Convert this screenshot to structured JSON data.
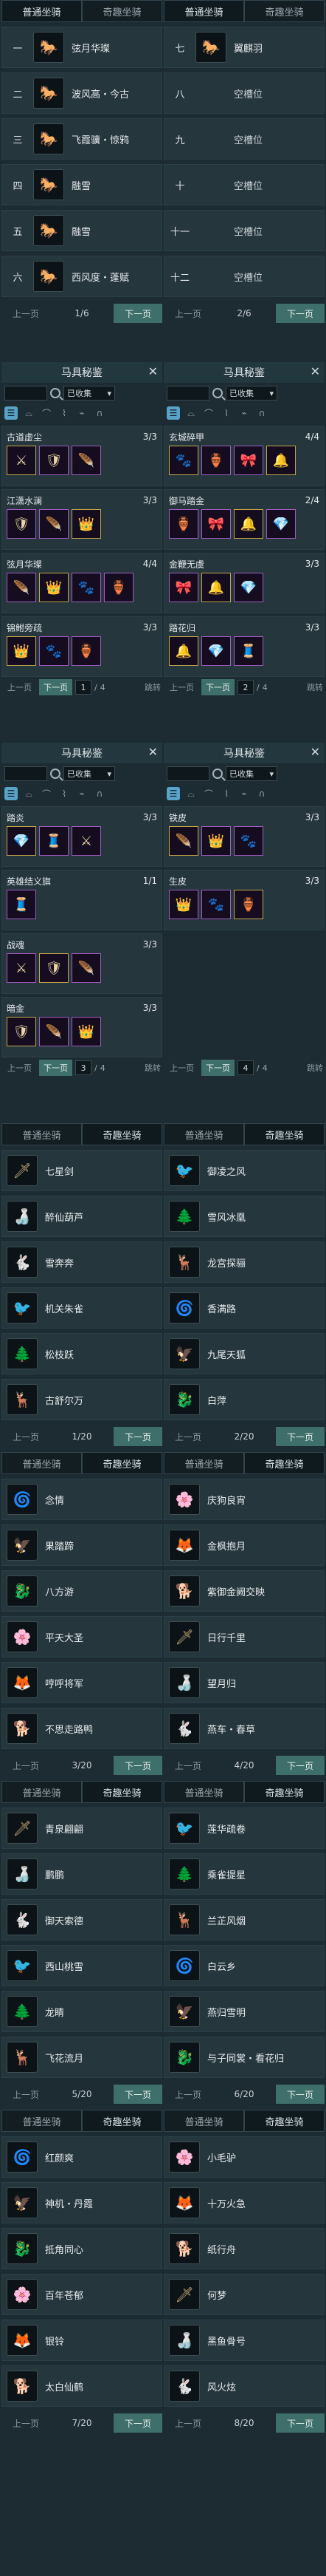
{
  "tabs": {
    "normal": "普通坐骑",
    "odd": "奇趣坐骑"
  },
  "pager": {
    "prev": "上一页",
    "next": "下一页"
  },
  "screen1": {
    "left": {
      "page": "1/6",
      "rows": [
        {
          "num": "一",
          "name": "弦月华璨"
        },
        {
          "num": "二",
          "name": "波风高・今古"
        },
        {
          "num": "三",
          "name": "飞霞骥・惊鸦"
        },
        {
          "num": "四",
          "name": "融雪"
        },
        {
          "num": "五",
          "name": "融雪"
        },
        {
          "num": "六",
          "name": "西风度・蓬赋"
        }
      ]
    },
    "right": {
      "page": "2/6",
      "rows": [
        {
          "num": "七",
          "name": "翼麒羽"
        },
        {
          "num": "八",
          "name": "空槽位"
        },
        {
          "num": "九",
          "name": "空槽位"
        },
        {
          "num": "十",
          "name": "空槽位"
        },
        {
          "num": "十一",
          "name": "空槽位"
        },
        {
          "num": "十二",
          "name": "空槽位"
        }
      ]
    }
  },
  "gear": {
    "title": "马具秘鉴",
    "collected": "已收集",
    "jump": "跳转",
    "panels": [
      {
        "page": "1",
        "total": "4",
        "sets": [
          {
            "name": "古道虚尘",
            "count": "3/3"
          },
          {
            "name": "江潇水澜",
            "count": "3/3"
          },
          {
            "name": "弦月华璨",
            "count": "4/4"
          },
          {
            "name": "锦鲋旁疏",
            "count": "3/3"
          }
        ]
      },
      {
        "page": "2",
        "total": "4",
        "sets": [
          {
            "name": "玄城碎甲",
            "count": "4/4"
          },
          {
            "name": "御马踏金",
            "count": "2/4"
          },
          {
            "name": "金鞭无虞",
            "count": "3/3"
          },
          {
            "name": "踏花归",
            "count": "3/3"
          }
        ]
      },
      {
        "page": "3",
        "total": "4",
        "sets": [
          {
            "name": "踏炎",
            "count": "3/3"
          },
          {
            "name": "英雄结义旗",
            "count": "1/1"
          },
          {
            "name": "战魂",
            "count": "3/3"
          },
          {
            "name": "暗金",
            "count": "3/3"
          }
        ]
      },
      {
        "page": "4",
        "total": "4",
        "sets": [
          {
            "name": "铁皮",
            "count": "3/3"
          },
          {
            "name": "生皮",
            "count": "3/3"
          },
          {
            "name": "",
            "count": ""
          },
          {
            "name": "",
            "count": ""
          }
        ]
      }
    ]
  },
  "odd_pages": [
    {
      "left": {
        "page": "1/20",
        "names": [
          "七星剑",
          "醉仙葫芦",
          "雪奔奔",
          "机关朱雀",
          "松枝跃",
          "古舒尔万"
        ]
      },
      "right": {
        "page": "2/20",
        "names": [
          "御凌之风",
          "雪风冰凰",
          "龙宫探骊",
          "香满路",
          "九尾天狐",
          "白萍"
        ]
      }
    },
    {
      "left": {
        "page": "3/20",
        "names": [
          "念情",
          "果踏蹄",
          "八方游",
          "平天大圣",
          "哼呼将军",
          "不思走路鸭"
        ]
      },
      "right": {
        "page": "4/20",
        "names": [
          "庆狗良宵",
          "金枫抱月",
          "紫御金阙交映",
          "日行千里",
          "望月归",
          "燕车・春草"
        ]
      }
    },
    {
      "left": {
        "page": "5/20",
        "names": [
          "青泉翩翩",
          "鹏鹏",
          "御天索德",
          "西山桃雪",
          "龙睛",
          "飞花流月"
        ]
      },
      "right": {
        "page": "6/20",
        "names": [
          "莲华疏卷",
          "乘雀提星",
          "兰芷风烟",
          "白云乡",
          "燕归雪明",
          "与子同裳・看花归"
        ]
      }
    },
    {
      "left": {
        "page": "7/20",
        "names": [
          "红颜爽",
          "神机・丹霞",
          "抵角同心",
          "百年苍郁",
          "银铃",
          "太白仙鹤"
        ]
      },
      "right": {
        "page": "8/20",
        "names": [
          "小毛驴",
          "十万火急",
          "纸行舟",
          "何梦",
          "黑鱼骨号",
          "风火炫"
        ]
      }
    }
  ]
}
